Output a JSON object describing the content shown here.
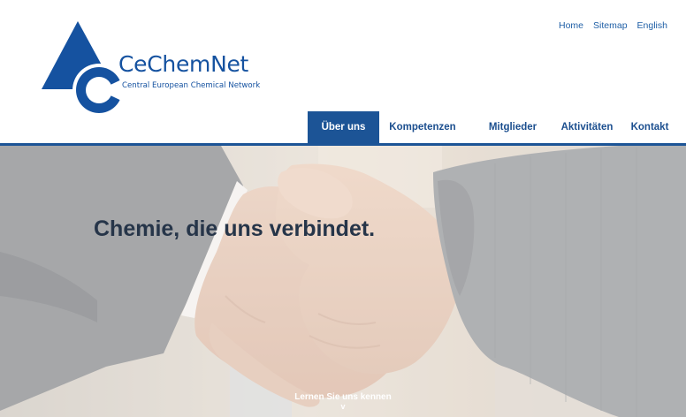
{
  "top_links": [
    {
      "label": "Home"
    },
    {
      "label": "Sitemap"
    },
    {
      "label": "English"
    }
  ],
  "logo": {
    "name": "CeChemNet",
    "subtitle": "Central European Chemical Network"
  },
  "nav": {
    "items": [
      {
        "label": "Über uns",
        "active": true
      },
      {
        "label": "Kompetenzen",
        "active": false
      },
      {
        "label": "Mitglieder",
        "active": false
      },
      {
        "label": "Aktivitäten",
        "active": false
      },
      {
        "label": "Kontakt",
        "active": false
      }
    ]
  },
  "hero": {
    "headline": "Chemie, die uns verbindet.",
    "cta_label": "Lernen Sie uns kennen",
    "cta_icon": "chevron-down-icon",
    "image": "handshake-photo"
  },
  "colors": {
    "brand_blue": "#1c5496",
    "link_blue": "#1f5fa6",
    "headline": "#263549"
  }
}
